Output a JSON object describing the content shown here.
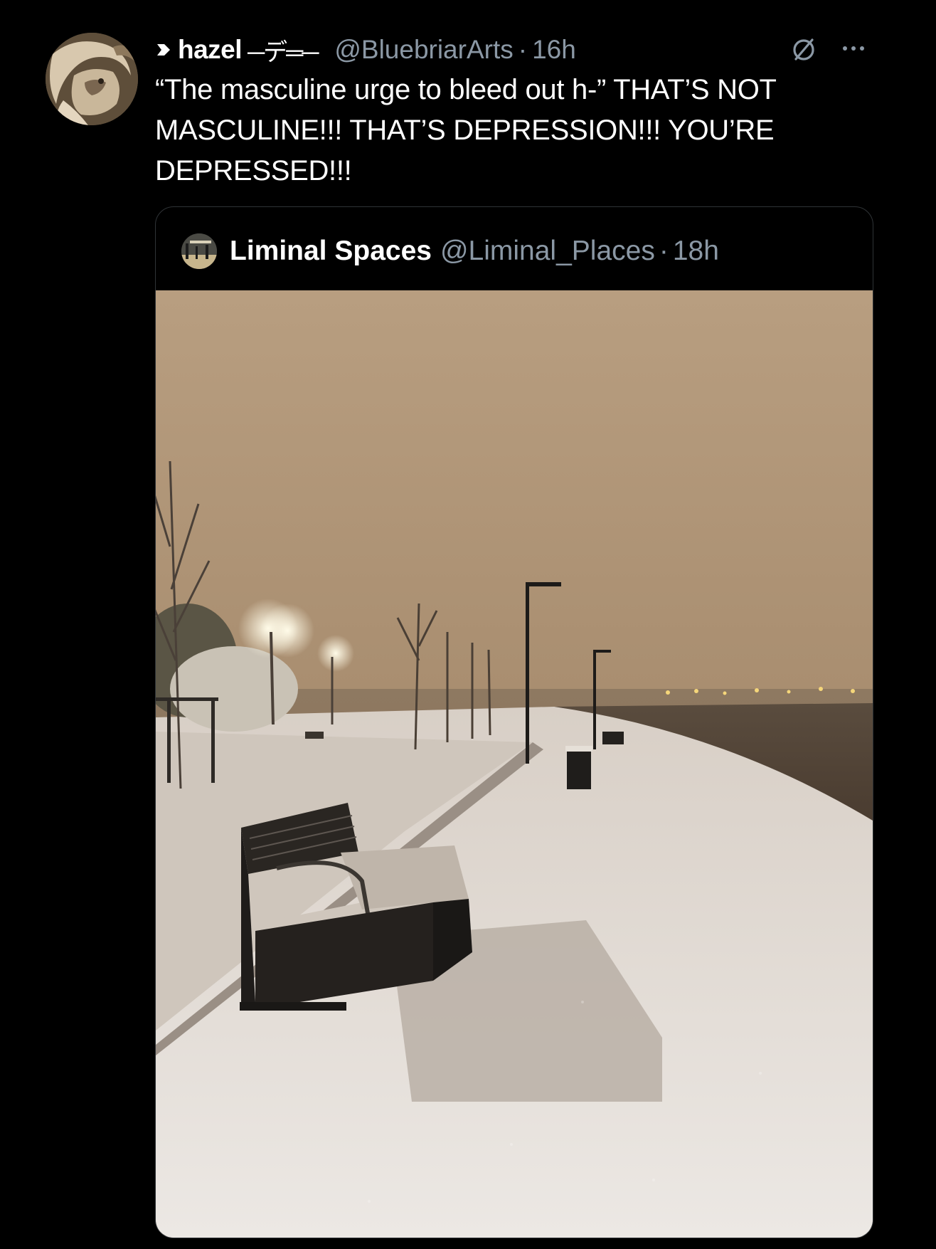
{
  "tweet": {
    "display_name": "hazel",
    "name_decoration": "─デ═─",
    "handle": "@BluebriarArts",
    "separator": "·",
    "time": "16h",
    "text": "“The masculine urge to bleed out h-” THAT’S NOT MASCULINE!!! THAT’S DEPRESSION!!! YOU’RE DEPRESSED!!!"
  },
  "quoted_tweet": {
    "display_name": "Liminal Spaces",
    "handle": "@Liminal_Places",
    "separator": "·",
    "time": "18h"
  },
  "icons": {
    "name_prefix": "arrow-badge-icon",
    "grok": "grok-icon",
    "more": "more-options-icon"
  },
  "colors": {
    "background": "#000000",
    "text_primary": "#ffffff",
    "text_secondary": "#8b98a5",
    "card_border": "#2f3336"
  }
}
